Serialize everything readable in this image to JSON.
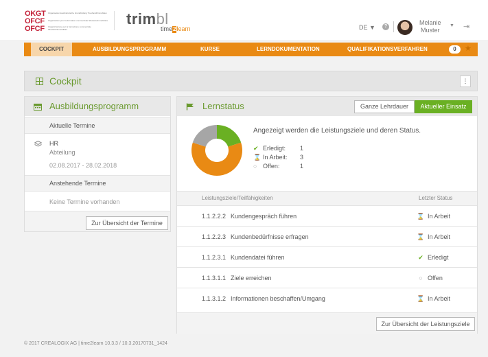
{
  "org": {
    "rows": [
      {
        "abbr": "OKGT",
        "desc": "Organisation kaufmännische Grundbildung Treuhand/Immobilien"
      },
      {
        "abbr": "OFCF",
        "desc": "Organisation pour la formation commerciale fiduciaire/immobilière"
      },
      {
        "abbr": "OFCF",
        "desc": "Organizzazione per la formazione commerciale fiduciaria/immobiliare"
      }
    ]
  },
  "brand": {
    "trim": "trim",
    "bl": "bl",
    "time": "time",
    "two": "2",
    "learn": "learn"
  },
  "header": {
    "language": "DE ▼",
    "help": "?",
    "user_first": "Melanie",
    "user_last": "Muster"
  },
  "nav": {
    "items": [
      "COCKPIT",
      "AUSBILDUNGSPROGRAMM",
      "KURSE",
      "LERNDOKUMENTATION",
      "QUALIFIKATIONSVERFAHREN"
    ],
    "badge": "0",
    "active_color": "#f7d6ab",
    "bar_color": "#e98a14"
  },
  "cockpit": {
    "title": "Cockpit",
    "menu": "⋮"
  },
  "ausbildung": {
    "title": "Ausbildungsprogramm",
    "current_label": "Aktuelle Termine",
    "entry_name": "HR",
    "entry_dept": "Abteilung",
    "entry_dates": "02.08.2017 - 28.02.2018",
    "upcoming_label": "Anstehende Termine",
    "none_text": "Keine Termine vorhanden",
    "overview_button": "Zur Übersicht der Termine"
  },
  "lernstatus": {
    "title": "Lernstatus",
    "seg_left": "Ganze Lehrdauer",
    "seg_right": "Aktueller Einsatz",
    "info": "Angezeigt werden die Leistungsziele und deren Status.",
    "legend": [
      {
        "icon": "✔",
        "label": "Erledigt:",
        "value": "1",
        "color": "#6ab023"
      },
      {
        "icon": "⌛",
        "label": "In Arbeit:",
        "value": "3",
        "color": "#e98a14"
      },
      {
        "icon": "○",
        "label": "Offen:",
        "value": "1",
        "color": "#aaaaaa"
      }
    ],
    "col_goal": "Leistungsziele/Teilfähigkeiten",
    "col_status": "Letzter Status",
    "rows": [
      {
        "code": "1.1.2.2.2",
        "name": "Kundengespräch führen",
        "status": "In Arbeit",
        "icon": "⌛"
      },
      {
        "code": "1.1.2.2.3",
        "name": "Kundenbedürfnisse erfragen",
        "status": "In Arbeit",
        "icon": "⌛"
      },
      {
        "code": "1.1.2.3.1",
        "name": "Kundendatei führen",
        "status": "Erledigt",
        "icon": "✔"
      },
      {
        "code": "1.1.3.1.1",
        "name": "Ziele erreichen",
        "status": "Offen",
        "icon": "○"
      },
      {
        "code": "1.1.3.1.2",
        "name": "Informationen beschaffen/Umgang",
        "status": "In Arbeit",
        "icon": "⌛"
      }
    ],
    "overview_button": "Zur Übersicht der Leistungsziele",
    "accent": "#6ab023"
  },
  "footer": {
    "copyright": "© 2017 CREALOGIX AG  |  time2learn 10.3.3 / 10.3.20170731_1424"
  }
}
